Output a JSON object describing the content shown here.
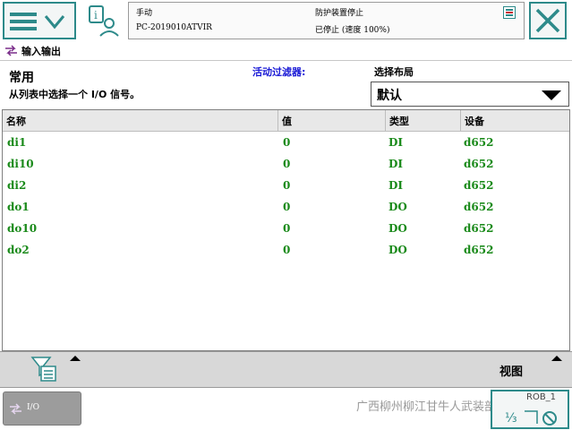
{
  "header": {
    "mode": "手动",
    "host": "PC-2019010ATVIR",
    "safety": "防护装置停止",
    "state": "已停止 (速度 100%)"
  },
  "window": {
    "title": "输入输出"
  },
  "filter": {
    "list_title": "常用",
    "list_hint": "从列表中选择一个 I/O 信号。",
    "active_filter_label": "活动过滤器:",
    "layout_label": "选择布局",
    "layout_value": "默认"
  },
  "table": {
    "columns": [
      "名称",
      "值",
      "类型",
      "设备"
    ],
    "rows": [
      {
        "name": "di1",
        "value": "0",
        "type": "DI",
        "device": "d652"
      },
      {
        "name": "di10",
        "value": "0",
        "type": "DI",
        "device": "d652"
      },
      {
        "name": "di2",
        "value": "0",
        "type": "DI",
        "device": "d652"
      },
      {
        "name": "do1",
        "value": "0",
        "type": "DO",
        "device": "d652"
      },
      {
        "name": "do10",
        "value": "0",
        "type": "DO",
        "device": "d652"
      },
      {
        "name": "do2",
        "value": "0",
        "type": "DO",
        "device": "d652"
      }
    ]
  },
  "toolbar": {
    "view_label": "视图"
  },
  "taskbar": {
    "io_label": "I/O",
    "version": "ROB_1",
    "watermark": "广西柳州柳江甘牛人武装部"
  },
  "colors": {
    "accent": "#2d8a8a",
    "value_text": "#1a8a1a",
    "filter_text": "#1a1ad6"
  },
  "icons": {
    "menu": "menu-icon",
    "info": "info-person-icon",
    "close": "close-icon",
    "io": "io-arrows-icon",
    "filter": "filter-icon",
    "quickset": "quickset-icon"
  }
}
